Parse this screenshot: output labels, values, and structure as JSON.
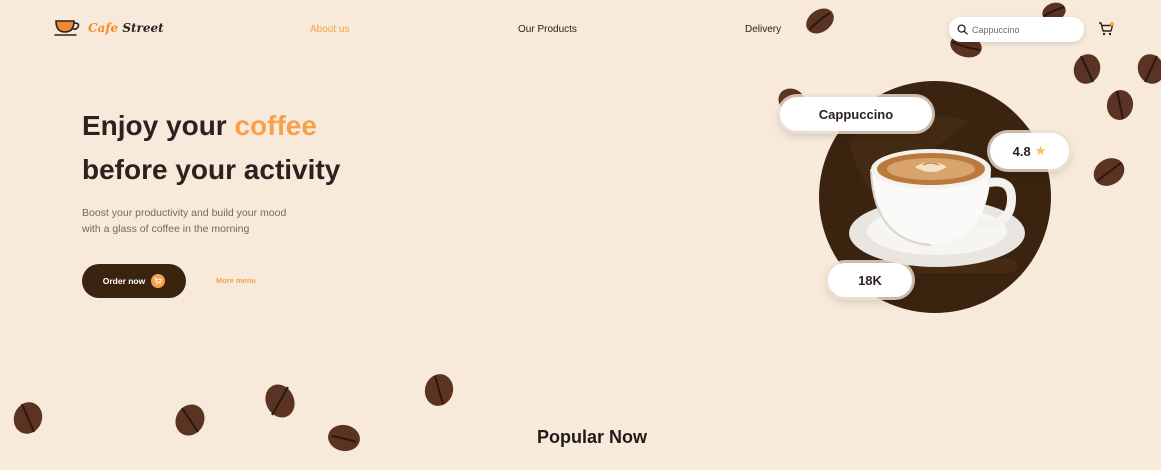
{
  "brand": {
    "name_part1": "Cafe",
    "name_part2": "Street",
    "icon": "coffee-cup-logo-icon"
  },
  "nav": {
    "items": [
      {
        "label": "About us",
        "active": true
      },
      {
        "label": "Our Products",
        "active": false
      },
      {
        "label": "Delivery",
        "active": false
      }
    ]
  },
  "search": {
    "placeholder": "Cappuccino",
    "icon": "search-icon"
  },
  "cart": {
    "icon": "cart-icon"
  },
  "hero": {
    "title_line1_prefix": "Enjoy your",
    "title_line1_accent": "coffee",
    "title_line2": "before your activity",
    "subtitle_line1": "Boost your productivity and build your mood",
    "subtitle_line2": "with a glass of coffee in the morning",
    "order_button": "Order now",
    "order_icon": "cart-icon",
    "more_link": "More menu"
  },
  "product_card": {
    "name": "Cappuccino",
    "rating": "4.8",
    "rating_icon": "star-icon",
    "count": "18K"
  },
  "section": {
    "title": "Popular Now"
  },
  "colors": {
    "background": "#f7eadb",
    "accent": "#f6a24b",
    "dark_brown": "#3a2410",
    "text": "#2b2220"
  }
}
